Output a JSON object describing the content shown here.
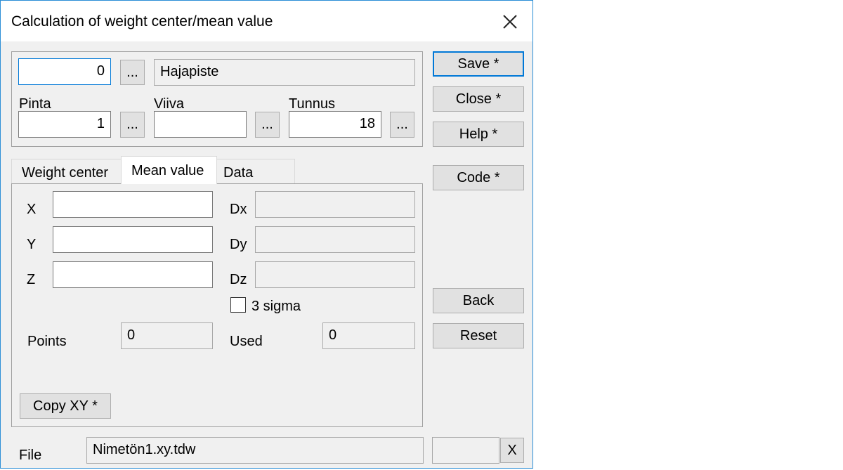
{
  "window": {
    "title": "Calculation of weight center/mean value"
  },
  "top": {
    "code_value": "0",
    "code_browse": "...",
    "code_name": "Hajapiste",
    "pinta_label": "Pinta",
    "pinta_value": "1",
    "pinta_browse": "...",
    "viiva_label": "Viiva",
    "viiva_value": "",
    "viiva_browse": "...",
    "tunnus_label": "Tunnus",
    "tunnus_value": "18",
    "tunnus_browse": "..."
  },
  "tabs": [
    {
      "label": "Weight center",
      "active": false
    },
    {
      "label": "Mean value",
      "active": true
    },
    {
      "label": "Data",
      "active": false
    }
  ],
  "mean": {
    "x_label": "X",
    "x_value": "",
    "y_label": "Y",
    "y_value": "",
    "z_label": "Z",
    "z_value": "",
    "dx_label": "Dx",
    "dx_value": "",
    "dy_label": "Dy",
    "dy_value": "",
    "dz_label": "Dz",
    "dz_value": "",
    "sigma_label": "3 sigma",
    "sigma_checked": false,
    "points_label": "Points",
    "points_value": "0",
    "used_label": "Used",
    "used_value": "0",
    "copy_button": "Copy XY *"
  },
  "side_buttons": {
    "save": "Save *",
    "close": "Close *",
    "help": "Help *",
    "code": "Code *",
    "back": "Back",
    "reset": "Reset"
  },
  "file": {
    "label": "File",
    "value": "Nimetön1.xy.tdw",
    "extra_value": "",
    "clear_button": "X"
  }
}
